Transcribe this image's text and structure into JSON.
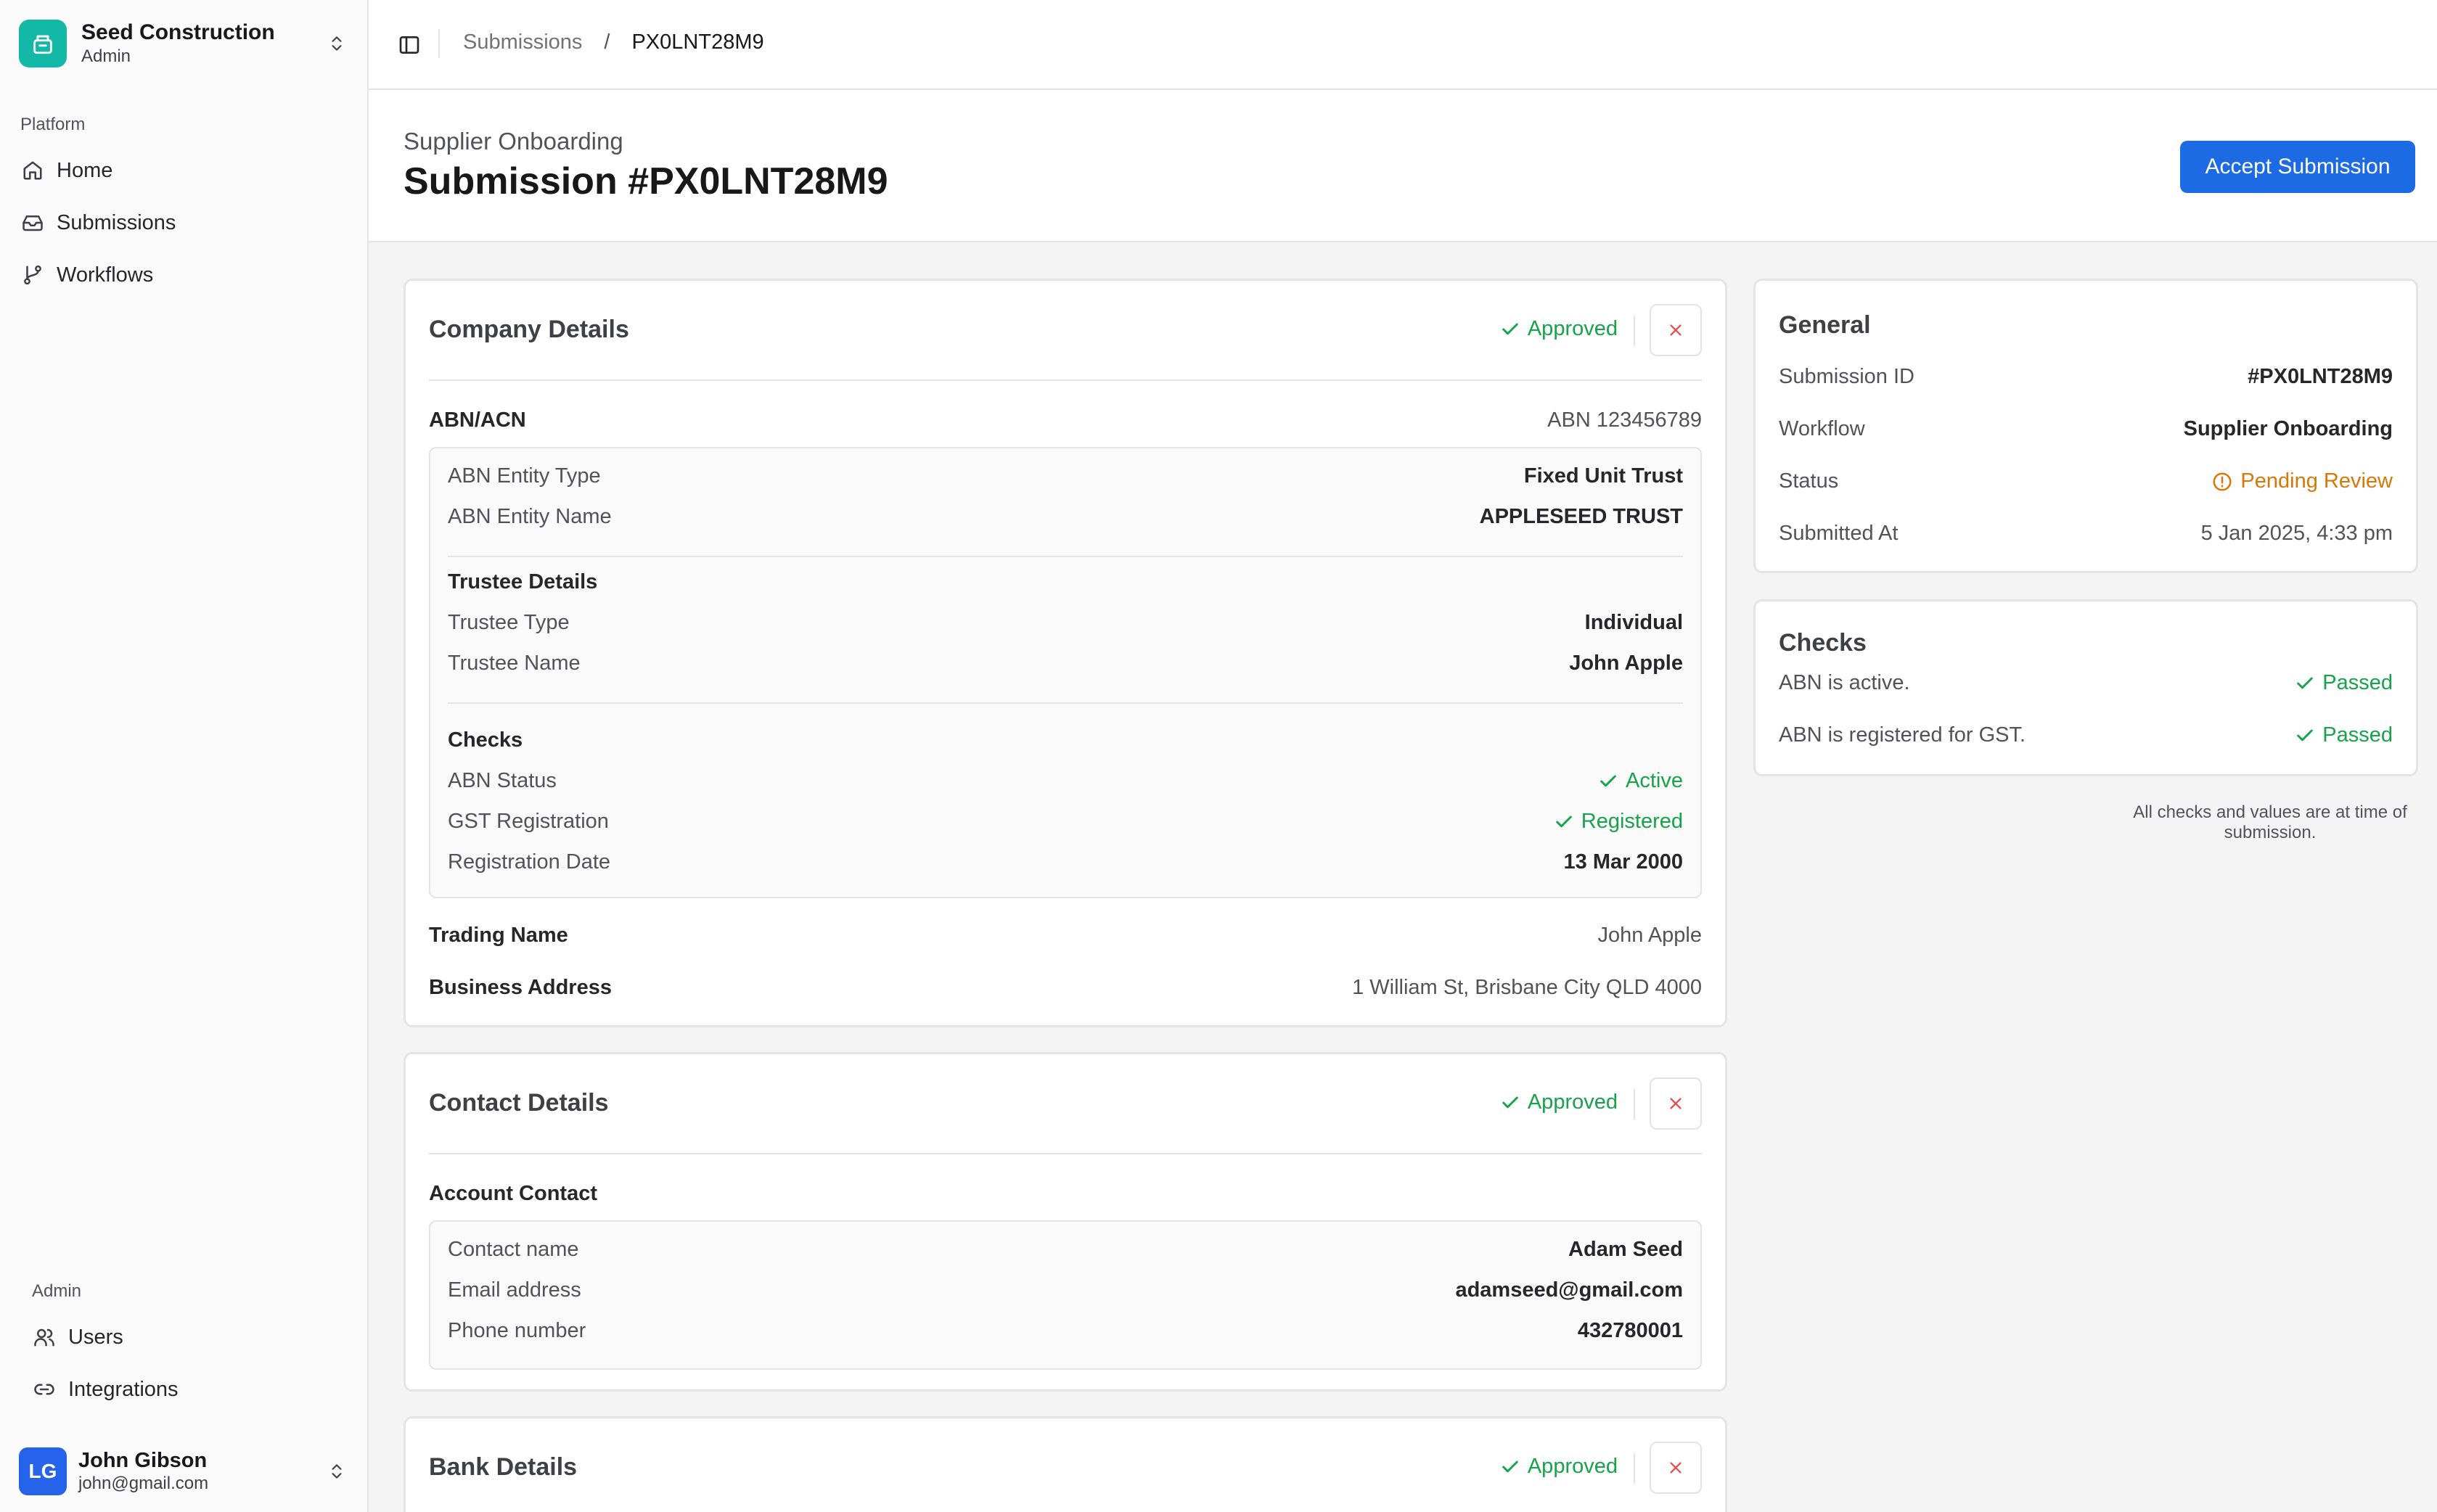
{
  "sidebar": {
    "org": {
      "name": "Seed Construction",
      "role": "Admin"
    },
    "platform_label": "Platform",
    "platform_items": [
      {
        "label": "Home",
        "icon": "home-icon"
      },
      {
        "label": "Submissions",
        "icon": "inbox-icon"
      },
      {
        "label": "Workflows",
        "icon": "git-branch-icon"
      }
    ],
    "admin_label": "Admin",
    "admin_items": [
      {
        "label": "Users",
        "icon": "users-icon"
      },
      {
        "label": "Integrations",
        "icon": "link-icon"
      }
    ],
    "user": {
      "initials": "LG",
      "name": "John Gibson",
      "email": "john@gmail.com"
    }
  },
  "breadcrumb": {
    "parent": "Submissions",
    "separator": "/",
    "current": "PX0LNT28M9"
  },
  "page": {
    "subtitle": "Supplier Onboarding",
    "title": "Submission #PX0LNT28M9",
    "accept_label": "Accept Submission"
  },
  "company": {
    "title": "Company Details",
    "status": "Approved",
    "abn_label": "ABN/ACN",
    "abn_value": "ABN 123456789",
    "entity_type_label": "ABN Entity Type",
    "entity_type_value": "Fixed Unit Trust",
    "entity_name_label": "ABN Entity Name",
    "entity_name_value": "APPLESEED TRUST",
    "trustee_heading": "Trustee Details",
    "trustee_type_label": "Trustee Type",
    "trustee_type_value": "Individual",
    "trustee_name_label": "Trustee Name",
    "trustee_name_value": "John Apple",
    "checks_heading": "Checks",
    "abn_status_label": "ABN Status",
    "abn_status_value": "Active",
    "gst_label": "GST Registration",
    "gst_value": "Registered",
    "reg_date_label": "Registration Date",
    "reg_date_value": "13 Mar 2000",
    "trading_label": "Trading Name",
    "trading_value": "John Apple",
    "address_label": "Business Address",
    "address_value": "1 William St, Brisbane City QLD 4000"
  },
  "contact": {
    "title": "Contact Details",
    "status": "Approved",
    "section_label": "Account Contact",
    "name_label": "Contact name",
    "name_value": "Adam Seed",
    "email_label": "Email address",
    "email_value": "adamseed@gmail.com",
    "phone_label": "Phone number",
    "phone_value": "432780001"
  },
  "bank": {
    "title": "Bank Details",
    "status": "Approved"
  },
  "general": {
    "title": "General",
    "id_label": "Submission ID",
    "id_value": "#PX0LNT28M9",
    "workflow_label": "Workflow",
    "workflow_value": "Supplier Onboarding",
    "status_label": "Status",
    "status_value": "Pending Review",
    "submitted_label": "Submitted At",
    "submitted_value": "5 Jan 2025, 4:33 pm"
  },
  "checks": {
    "title": "Checks",
    "items": [
      {
        "label": "ABN is active.",
        "result": "Passed"
      },
      {
        "label": "ABN is registered for GST.",
        "result": "Passed"
      }
    ],
    "footnote": "All checks and values are at time of submission."
  },
  "colors": {
    "accent": "#1d6ae5",
    "brand": "#14b8a6",
    "success": "#16a34a",
    "warning": "#d97706",
    "danger": "#ef4444"
  }
}
